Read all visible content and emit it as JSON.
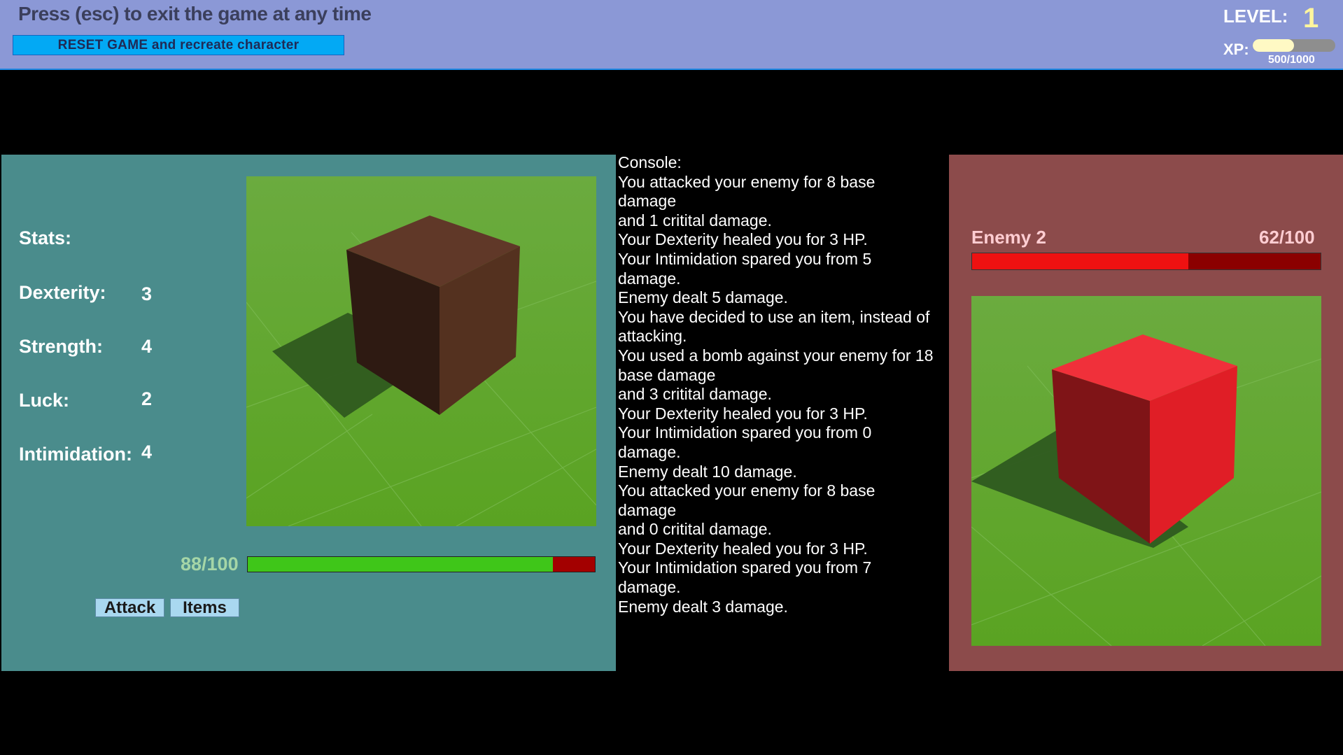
{
  "header": {
    "hint": "Press (esc) to exit the game at any time",
    "reset_label": "RESET GAME and recreate character",
    "level_label": "LEVEL:",
    "level_value": "1",
    "xp_label": "XP:",
    "xp_text": "500/1000",
    "xp_fraction": 0.5
  },
  "player": {
    "stats_title": "Stats:",
    "stats": [
      {
        "label": "Dexterity:",
        "value": "3"
      },
      {
        "label": "Strength:",
        "value": "4"
      },
      {
        "label": "Luck:",
        "value": "2"
      },
      {
        "label": "Intimidation:",
        "value": "4"
      }
    ],
    "hp_text": "88/100",
    "hp_fraction": 0.88,
    "attack_label": "Attack",
    "items_label": "Items",
    "cube_color": "#5a3322"
  },
  "console": {
    "lines": [
      "Console:",
      "You attacked your enemy for 8 base",
      "damage",
      "and 1 critital damage.",
      "Your Dexterity healed you for 3 HP.",
      "Your Intimidation spared you from 5",
      "damage.",
      "Enemy dealt 5 damage.",
      "You have decided to use an item, instead of",
      "attacking.",
      "You used a bomb against your enemy for 18",
      "base damage",
      "and 3 critital damage.",
      "Your Dexterity healed you for 3 HP.",
      "Your Intimidation spared you from 0",
      "damage.",
      "Enemy dealt 10 damage.",
      "You attacked your enemy for 8 base",
      "damage",
      "and 0 critital damage.",
      "Your Dexterity healed you for 3 HP.",
      "Your Intimidation spared you from 7",
      "damage.",
      "Enemy dealt 3 damage."
    ]
  },
  "enemy": {
    "name": "Enemy 2",
    "hp_text": "62/100",
    "hp_fraction": 0.62,
    "cube_color": "#e8232a"
  },
  "colors": {
    "topbar": "#8b98d6",
    "player_panel": "#4a8c8c",
    "enemy_panel": "#8c4b4b",
    "hp_green": "#3fc619",
    "hp_red": "#ee1111"
  }
}
